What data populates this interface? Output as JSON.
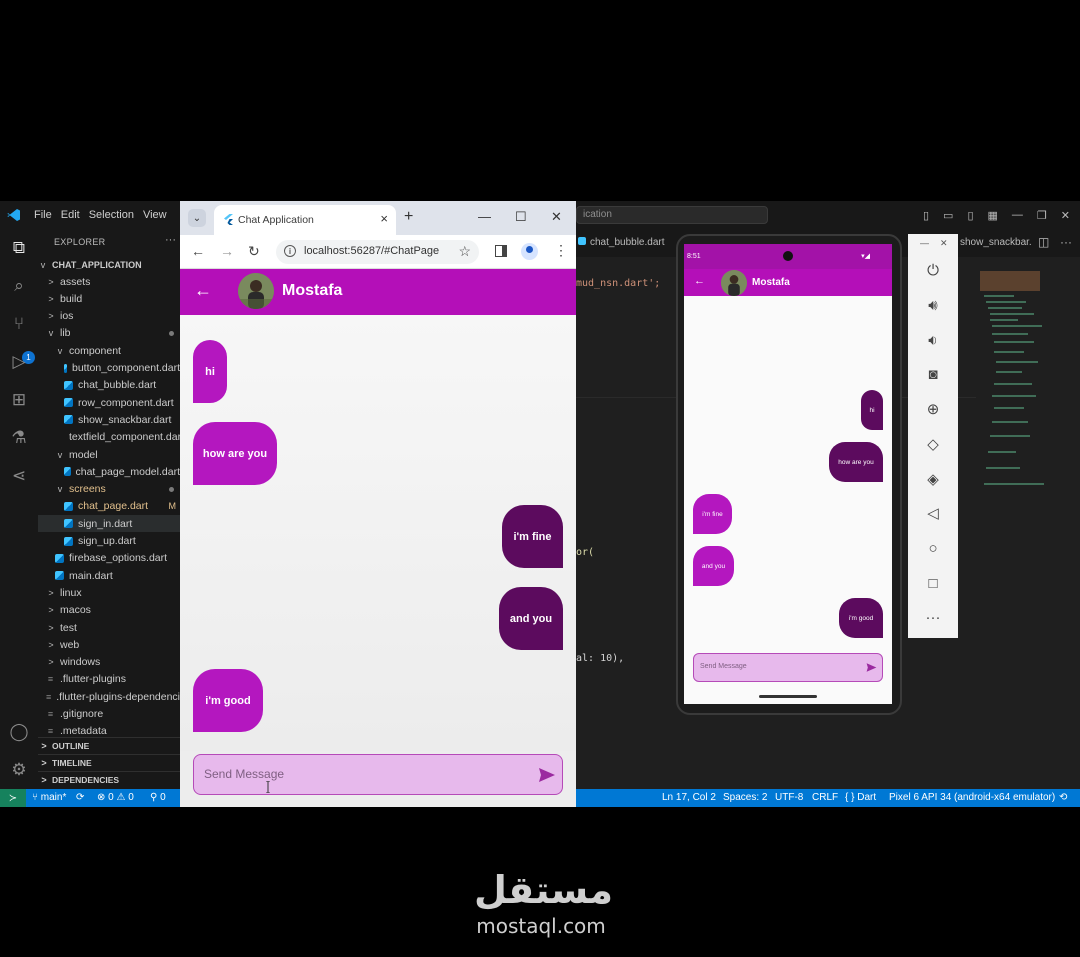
{
  "vscode": {
    "menu": [
      "File",
      "Edit",
      "Selection",
      "View"
    ],
    "command_center": "ication",
    "explorer_title": "EXPLORER",
    "project": "CHAT_APPLICATION",
    "tree": [
      {
        "label": "assets",
        "kind": "folder",
        "indent": 1,
        "chev": ">"
      },
      {
        "label": "build",
        "kind": "folder",
        "indent": 1,
        "chev": ">"
      },
      {
        "label": "ios",
        "kind": "folder",
        "indent": 1,
        "chev": ">"
      },
      {
        "label": "lib",
        "kind": "folder",
        "indent": 1,
        "chev": "v",
        "dot": true
      },
      {
        "label": "component",
        "kind": "folder",
        "indent": 2,
        "chev": "v"
      },
      {
        "label": "button_component.dart",
        "kind": "dart",
        "indent": 3
      },
      {
        "label": "chat_bubble.dart",
        "kind": "dart",
        "indent": 3
      },
      {
        "label": "row_component.dart",
        "kind": "dart",
        "indent": 3
      },
      {
        "label": "show_snackbar.dart",
        "kind": "dart",
        "indent": 3
      },
      {
        "label": "textfield_component.dart",
        "kind": "dart",
        "indent": 3
      },
      {
        "label": "model",
        "kind": "folder",
        "indent": 2,
        "chev": "v"
      },
      {
        "label": "chat_page_model.dart",
        "kind": "dart",
        "indent": 3
      },
      {
        "label": "screens",
        "kind": "folder",
        "indent": 2,
        "chev": "v",
        "modified": true,
        "dot": true
      },
      {
        "label": "chat_page.dart",
        "kind": "dart",
        "indent": 3,
        "modified": true,
        "badge": "M"
      },
      {
        "label": "sign_in.dart",
        "kind": "dart",
        "indent": 3,
        "selected": true
      },
      {
        "label": "sign_up.dart",
        "kind": "dart",
        "indent": 3
      },
      {
        "label": "firebase_options.dart",
        "kind": "dart",
        "indent": 2
      },
      {
        "label": "main.dart",
        "kind": "dart",
        "indent": 2
      },
      {
        "label": "linux",
        "kind": "folder",
        "indent": 1,
        "chev": ">"
      },
      {
        "label": "macos",
        "kind": "folder",
        "indent": 1,
        "chev": ">"
      },
      {
        "label": "test",
        "kind": "folder",
        "indent": 1,
        "chev": ">"
      },
      {
        "label": "web",
        "kind": "folder",
        "indent": 1,
        "chev": ">"
      },
      {
        "label": "windows",
        "kind": "folder",
        "indent": 1,
        "chev": ">"
      },
      {
        "label": ".flutter-plugins",
        "kind": "file",
        "indent": 1
      },
      {
        "label": ".flutter-plugins-dependencies",
        "kind": "file",
        "indent": 1
      },
      {
        "label": ".gitignore",
        "kind": "file",
        "indent": 1
      },
      {
        "label": ".metadata",
        "kind": "file",
        "indent": 1
      }
    ],
    "sections": [
      "OUTLINE",
      "TIMELINE",
      "DEPENDENCIES"
    ],
    "editor_tabs": {
      "tab1": "chat_bubble.dart",
      "tab2": "show_snackbar."
    },
    "code": {
      "line1": "mud_nsn.dart';",
      "line2": "or(",
      "line3": "al: 10),"
    },
    "source_control_badge": "1",
    "status": {
      "branch": "main*",
      "errors": "0",
      "warnings": "0",
      "ports": "0",
      "position": "Ln 17, Col 2",
      "spaces": "Spaces: 2",
      "encoding": "UTF-8",
      "eol": "CRLF",
      "language": "Dart",
      "device": "Pixel 6 API 34 (android-x64 emulator)"
    }
  },
  "browser": {
    "tab_title": "Chat Application",
    "url": "localhost:56287/#ChatPage"
  },
  "chat": {
    "contact": "Mostafa",
    "messages": [
      {
        "text": "hi",
        "side": "in"
      },
      {
        "text": "how are you",
        "side": "in"
      },
      {
        "text": "i'm fine",
        "side": "out"
      },
      {
        "text": "and you",
        "side": "out"
      },
      {
        "text": "i'm good",
        "side": "in"
      }
    ],
    "placeholder": "Send Message"
  },
  "phone": {
    "time": "8:51",
    "contact": "Mostafa",
    "messages": [
      {
        "text": "hi",
        "side": "out"
      },
      {
        "text": "how are you",
        "side": "out"
      },
      {
        "text": "i'm fine",
        "side": "in"
      },
      {
        "text": "and you",
        "side": "in"
      },
      {
        "text": "i'm good",
        "side": "out"
      }
    ],
    "placeholder": "Send Message"
  },
  "watermark": {
    "arabic": "مستقل",
    "latin": "mostaql.com"
  },
  "colors": {
    "app_bar": "#b40fb8",
    "incoming": "#b417bf",
    "outgoing": "#5c0b5e",
    "status_bar": "#0078d4"
  }
}
